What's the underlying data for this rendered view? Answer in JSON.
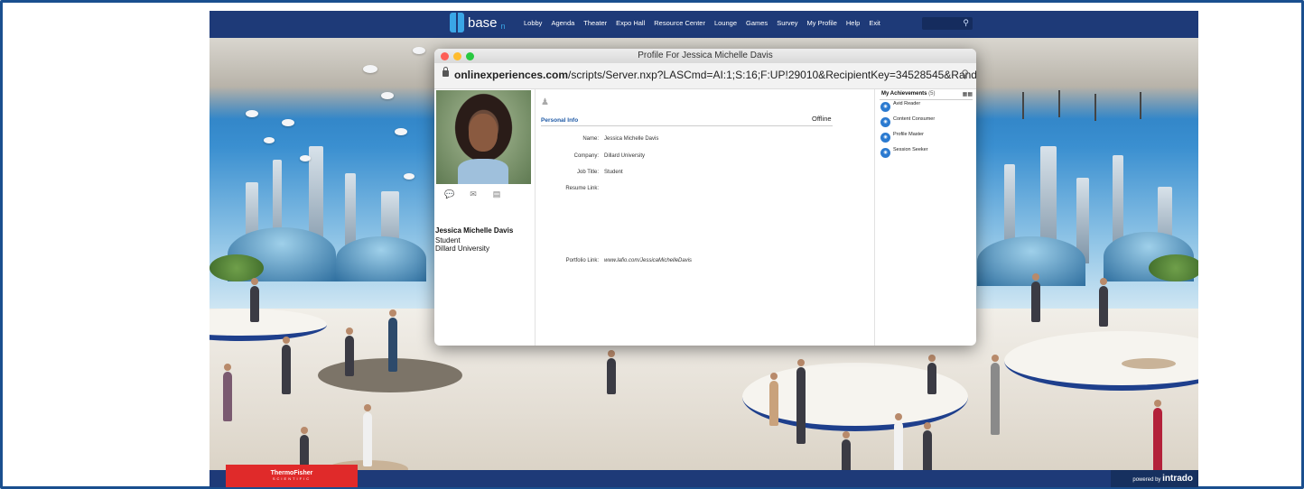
{
  "nav": {
    "logo_text": "base",
    "logo_sub": "n",
    "items": [
      "Lobby",
      "Agenda",
      "Theater",
      "Expo Hall",
      "Resource Center",
      "Lounge",
      "Games",
      "Survey",
      "My Profile",
      "Help",
      "Exit"
    ],
    "search_icon": "search-icon"
  },
  "footer": {
    "sponsor_line1": "ThermoFisher",
    "sponsor_line2": "SCIENTIFIC",
    "powered_by": "powered by",
    "powered_brand": "intrado"
  },
  "window": {
    "title": "Profile For Jessica Michelle Davis",
    "url_domain": "onlinexperiences.com",
    "url_path": "/scripts/Server.nxp?LASCmd=AI:1;S:16;F:UP!29010&RecipientKey=34528545&Rand...",
    "traffic_colors": [
      "#fd5f57",
      "#febc2e",
      "#28c840"
    ]
  },
  "profile": {
    "name": "Jessica Michelle Davis",
    "title": "Student",
    "company": "Dillard University",
    "action_icons": [
      "chat-icon",
      "mail-icon",
      "vcard-icon"
    ],
    "section_title": "Personal Info",
    "status": "Offline",
    "fields": [
      {
        "label": "Name:",
        "value": "Jessica Michelle Davis"
      },
      {
        "label": "Company:",
        "value": "Dillard University"
      },
      {
        "label": "Job Title:",
        "value": "Student"
      },
      {
        "label": "Resume Link:",
        "value": ""
      }
    ],
    "portfolio_label": "Portfolio Link:",
    "portfolio_value": "www.lafio.com/JessicaMichelleDavis"
  },
  "achievements": {
    "heading": "My Achievements",
    "count": "(5)",
    "items": [
      "Avid Reader",
      "Content Consumer",
      "Profile Master",
      "Session Seeker"
    ]
  }
}
